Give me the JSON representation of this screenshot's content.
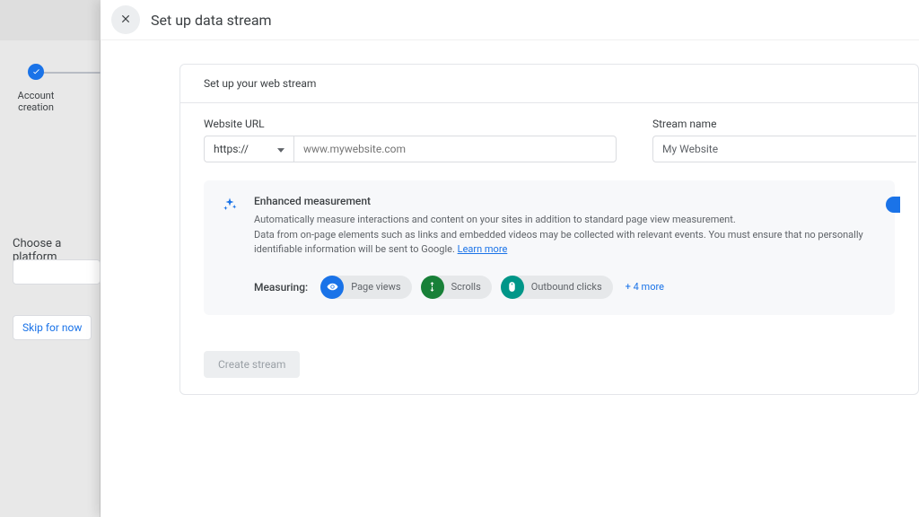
{
  "background": {
    "step_label": "Account creation",
    "choose_label": "Choose a platform",
    "skip_label": "Skip for now"
  },
  "panel": {
    "title": "Set up data stream"
  },
  "card": {
    "subtitle": "Set up your web stream",
    "url_label": "Website URL",
    "protocol": "https://",
    "url_placeholder": "www.mywebsite.com",
    "stream_label": "Stream name",
    "stream_value": "My Website"
  },
  "enhanced": {
    "title": "Enhanced measurement",
    "line1": "Automatically measure interactions and content on your sites in addition to standard page view measurement.",
    "line2": "Data from on-page elements such as links and embedded videos may be collected with relevant events. You must ensure that no personally identifiable information will be sent to Google.",
    "learn_more": "Learn more"
  },
  "measuring": {
    "label": "Measuring:",
    "pills": [
      {
        "label": "Page views",
        "color": "blue"
      },
      {
        "label": "Scrolls",
        "color": "green"
      },
      {
        "label": "Outbound clicks",
        "color": "teal"
      }
    ],
    "more": "+ 4 more"
  },
  "create_button": "Create stream"
}
